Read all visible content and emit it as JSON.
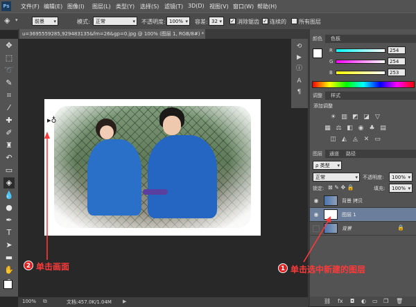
{
  "menubar": {
    "logo": "Ps",
    "items": [
      "文件(F)",
      "编辑(E)",
      "图像(I)",
      "图层(L)",
      "类型(Y)",
      "选择(S)",
      "滤镜(T)",
      "3D(D)",
      "视图(V)",
      "窗口(W)",
      "帮助(H)"
    ]
  },
  "options": {
    "fill_source": "前景",
    "mode_label": "模式:",
    "mode_value": "正常",
    "opacity_label": "不透明度:",
    "opacity_value": "100%",
    "tolerance_label": "容差:",
    "tolerance_value": "32",
    "antialias_label": "消除锯齿",
    "contiguous_label": "连续的",
    "all_layers_label": "所有图层"
  },
  "document": {
    "tab_title": "u=3695559285,929483135&fm=26&gp=0.jpg @ 100% (图层 1, RGB/8#) *"
  },
  "status": {
    "zoom": "100%",
    "doc_info": "文档:457.0K/1.04M"
  },
  "color_panel": {
    "tabs": [
      "颜色",
      "色板"
    ],
    "channels": [
      {
        "label": "R",
        "value": "254"
      },
      {
        "label": "G",
        "value": "254"
      },
      {
        "label": "B",
        "value": "253"
      }
    ]
  },
  "adjust_panel": {
    "tabs": [
      "调整",
      "样式"
    ],
    "title": "添加调整"
  },
  "layers_panel": {
    "tabs": [
      "图层",
      "通道",
      "路径"
    ],
    "filter_label": "ρ 类型",
    "blend_mode": "正常",
    "opacity_label": "不透明度:",
    "opacity_value": "100%",
    "lock_label": "锁定:",
    "fill_label": "填充:",
    "fill_value": "100%",
    "layers": [
      {
        "name": "背景 拷贝",
        "visible": true,
        "selected": false
      },
      {
        "name": "图层 1",
        "visible": true,
        "selected": true
      },
      {
        "name": "背景",
        "visible": false,
        "selected": false
      }
    ]
  },
  "annotations": {
    "step1_num": "1",
    "step1_text": "单击选中新建的图层",
    "step2_num": "2",
    "step2_text": "单击画面"
  },
  "colors": {
    "accent_red": "#ff3a3a",
    "selected_layer": "#6b7f9c"
  }
}
